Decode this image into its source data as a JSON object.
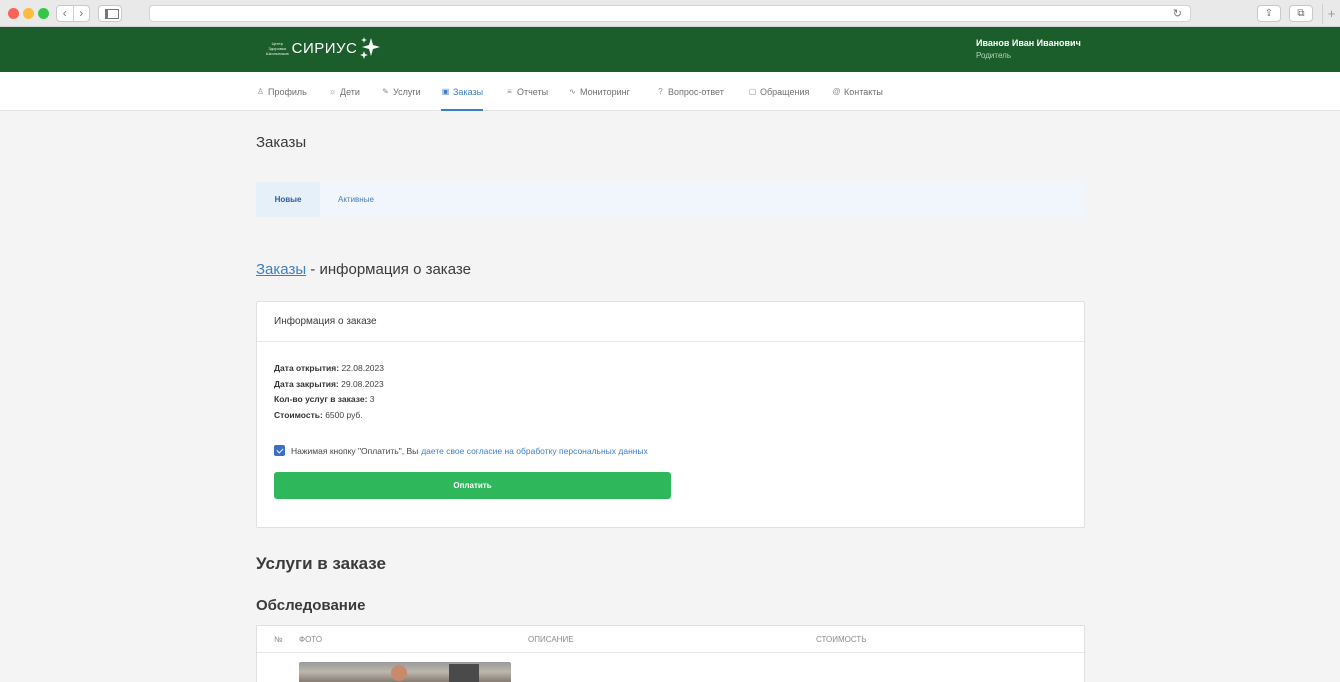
{
  "browser": {
    "back_label": "‹",
    "forward_label": "›",
    "reload_icon": "↻",
    "share_icon": "⇪",
    "tabs_icon": "⧉",
    "newtab_icon": "+"
  },
  "header": {
    "logo_small_lines": [
      "Центр",
      "Здоровья",
      "Школьников"
    ],
    "logo_name": "СИРИУС",
    "user_name": "Иванов Иван Иванович",
    "user_role": "Родитель",
    "brand_color": "#1b5e2b"
  },
  "nav": {
    "items": [
      {
        "icon": "person-icon",
        "glyph": "♙",
        "label": "Профиль"
      },
      {
        "icon": "sun-icon",
        "glyph": "☼",
        "label": "Дети"
      },
      {
        "icon": "edit-icon",
        "glyph": "✎",
        "label": "Услуги"
      },
      {
        "icon": "calendar-icon",
        "glyph": "▣",
        "label": "Заказы",
        "active": true
      },
      {
        "icon": "list-icon",
        "glyph": "≡",
        "label": "Отчеты"
      },
      {
        "icon": "activity-icon",
        "glyph": "∿",
        "label": "Мониторинг"
      },
      {
        "icon": "question-icon",
        "glyph": "?",
        "label": "Вопрос-ответ"
      },
      {
        "icon": "chat-icon",
        "glyph": "▢",
        "label": "Обращения"
      },
      {
        "icon": "at-icon",
        "glyph": "@",
        "label": "Контакты"
      }
    ],
    "active_color": "#3c7fc7"
  },
  "page": {
    "title": "Заказы",
    "tabs": [
      {
        "label": "Новые",
        "active": true
      },
      {
        "label": "Активные"
      }
    ],
    "order_link": "Заказы",
    "order_suffix": " - информация о заказе"
  },
  "card": {
    "header": "Информация о заказе",
    "fields": [
      {
        "label": "Дата открытия:",
        "value": "22.08.2023"
      },
      {
        "label": "Дата закрытия:",
        "value": "29.08.2023"
      },
      {
        "label": "Кол-во услуг в заказе:",
        "value": "3"
      },
      {
        "label": "Стоимость:",
        "value": "6500 руб."
      }
    ],
    "consent_text": "Нажимая кнопку \"Оплатить\", Вы",
    "consent_link": "даете свое согласие на обработку персональных данных",
    "consent_checked": true,
    "pay_label": "Оплатить",
    "pay_color": "#2fb85b"
  },
  "services": {
    "title": "Услуги в заказе",
    "section": "Обследование",
    "columns": [
      "№",
      "Фото",
      "Описание",
      "Стоимость"
    ]
  }
}
